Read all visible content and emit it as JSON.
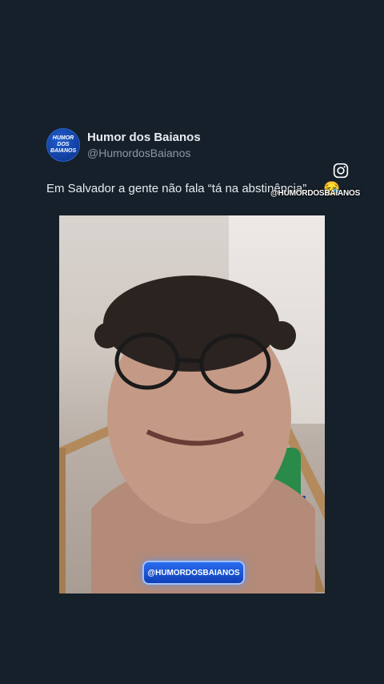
{
  "profile": {
    "avatar_text_line1": "HUMOR",
    "avatar_text_line2": "DOS",
    "avatar_text_line3": "BAIANOS",
    "display_name": "Humor dos Baianos",
    "handle": "@HumordosBaianos"
  },
  "post": {
    "text": "Em Salvador a gente não fala “tá na abstinência”",
    "emoji": "😪"
  },
  "watermark": {
    "icon": "instagram-icon",
    "handle": "@HUMORDOSBAIANOS"
  },
  "video": {
    "badge_text": "@HUMORDOSBAIANOS"
  },
  "colors": {
    "background": "#16202b",
    "badge": "#1f55d6"
  }
}
